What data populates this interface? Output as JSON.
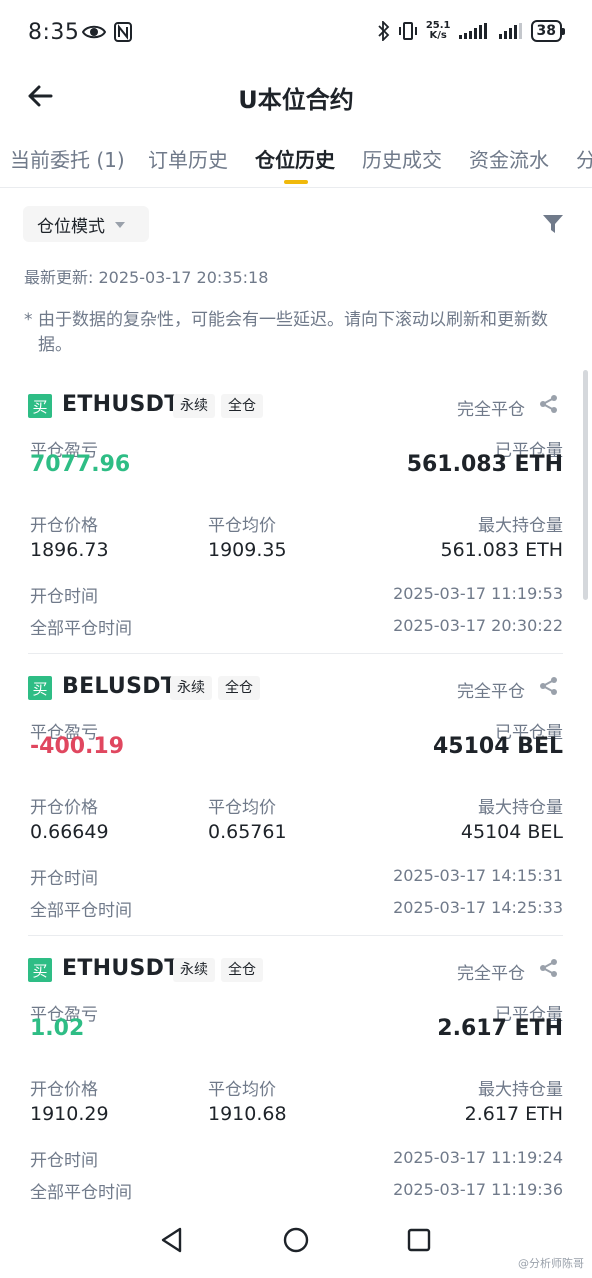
{
  "status_bar": {
    "time": "8:35",
    "speed": "25.1",
    "speed_unit": "K/s",
    "battery": "38"
  },
  "header": {
    "title": "U本位合约"
  },
  "tabs": [
    {
      "label": "当前委托 (1)"
    },
    {
      "label": "订单历史"
    },
    {
      "label": "仓位历史",
      "active": true
    },
    {
      "label": "历史成交"
    },
    {
      "label": "资金流水"
    },
    {
      "label": "分"
    }
  ],
  "filter": {
    "mode_label": "仓位模式"
  },
  "last_update": "最新更新: 2025-03-17 20:35:18",
  "notice": {
    "star": "*",
    "text": "由于数据的复杂性，可能会有一些延迟。请向下滚动以刷新和更新数据。"
  },
  "labels": {
    "pnl": "平仓盈亏",
    "closed_qty": "已平仓量",
    "open_price": "开仓价格",
    "close_avg": "平仓均价",
    "max_position": "最大持仓量",
    "open_time": "开仓时间",
    "full_close_time": "全部平仓时间"
  },
  "positions": [
    {
      "side": "买",
      "symbol": "ETHUSDT",
      "tag_type": "永续",
      "tag_margin": "全仓",
      "status": "完全平仓",
      "pnl": "7077.96",
      "pnl_sign": "positive",
      "closed_qty": "561.083 ETH",
      "open_price": "1896.73",
      "close_avg": "1909.35",
      "max_position": "561.083 ETH",
      "open_time": "2025-03-17 11:19:53",
      "full_close_time": "2025-03-17 20:30:22"
    },
    {
      "side": "买",
      "symbol": "BELUSDT",
      "tag_type": "永续",
      "tag_margin": "全仓",
      "status": "完全平仓",
      "pnl": "-400.19",
      "pnl_sign": "negative",
      "closed_qty": "45104 BEL",
      "open_price": "0.66649",
      "close_avg": "0.65761",
      "max_position": "45104 BEL",
      "open_time": "2025-03-17 14:15:31",
      "full_close_time": "2025-03-17 14:25:33"
    },
    {
      "side": "买",
      "symbol": "ETHUSDT",
      "tag_type": "永续",
      "tag_margin": "全仓",
      "status": "完全平仓",
      "pnl": "1.02",
      "pnl_sign": "positive",
      "closed_qty": "2.617 ETH",
      "open_price": "1910.29",
      "close_avg": "1910.68",
      "max_position": "2.617 ETH",
      "open_time": "2025-03-17 11:19:24",
      "full_close_time": "2025-03-17 11:19:36"
    }
  ],
  "watermark": "@分析师陈哥",
  "colors": {
    "positive": "#2ebd85",
    "negative": "#e0475f",
    "accent": "#f0b90b",
    "text_primary": "#1e2329",
    "text_secondary": "#707a8a"
  }
}
